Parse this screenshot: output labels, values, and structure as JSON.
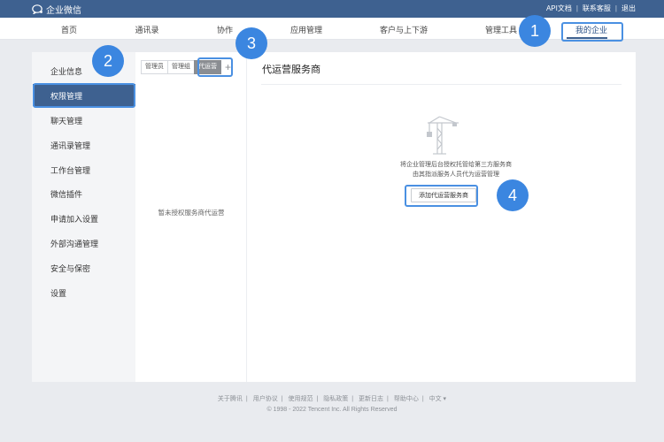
{
  "header": {
    "brand": "企业微信",
    "links": [
      "API文档",
      "联系客服",
      "退出"
    ]
  },
  "nav": {
    "items": [
      "首页",
      "通讯录",
      "协作",
      "应用管理",
      "客户与上下游",
      "管理工具",
      "我的企业"
    ],
    "active_index": 6
  },
  "sidebar": {
    "items": [
      "企业信息",
      "权限管理",
      "聊天管理",
      "通讯录管理",
      "工作台管理",
      "微信插件",
      "申请加入设置",
      "外部沟通管理",
      "安全与保密",
      "设置"
    ],
    "active_index": 1
  },
  "tabs": {
    "items": [
      "管理员",
      "管理组",
      "代运营"
    ],
    "active_index": 2,
    "add_symbol": "+"
  },
  "left_panel": {
    "empty_text": "暂未授权服务商代运营"
  },
  "main": {
    "title": "代运营服务商",
    "desc_line1": "将企业管理后台授权托管给第三方服务商",
    "desc_line2": "由其指派服务人员代为运营管理",
    "button_label": "添加代运营服务商"
  },
  "badges": [
    "1",
    "2",
    "3",
    "4"
  ],
  "footer": {
    "links": [
      "关于腾讯",
      "用户协议",
      "使用规范",
      "隐私政策",
      "更新日志",
      "帮助中心",
      "中文 ▾"
    ],
    "copyright": "© 1998 - 2022 Tencent Inc. All Rights Reserved"
  },
  "colors": {
    "accent": "#3e6190",
    "highlight": "#4a90e2",
    "badge": "#3b86e0"
  }
}
